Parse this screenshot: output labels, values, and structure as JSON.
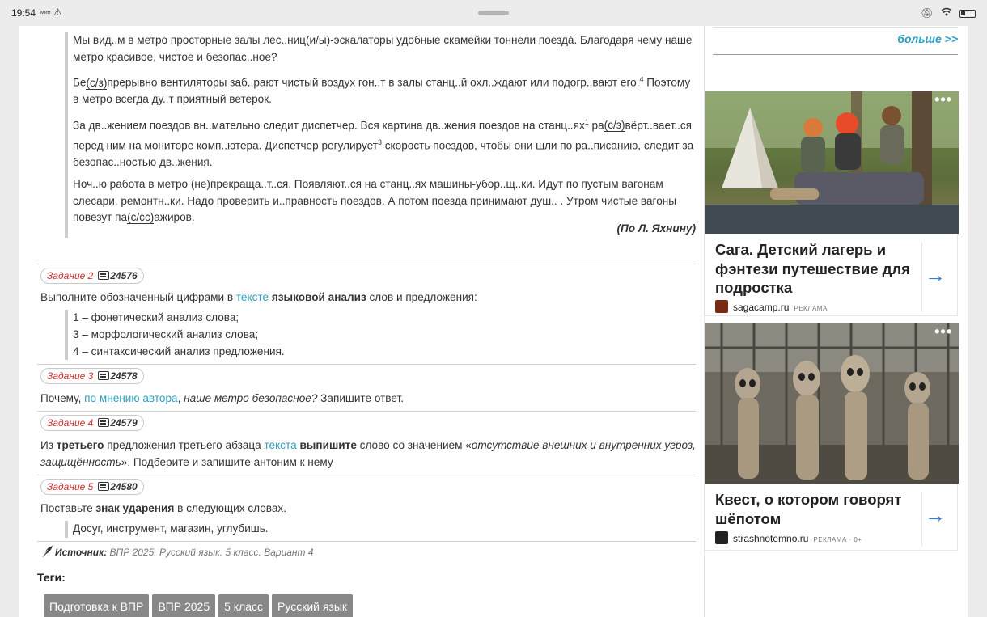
{
  "status_bar": {
    "time": "19:54",
    "mini_label": "мин",
    "warning_icon": "warning-triangle-icon",
    "icons": [
      "bell-muted-icon",
      "wifi-icon",
      "battery-icon"
    ]
  },
  "text": {
    "p1": "Мы вид..м в метро просторные залы лес..ниц(и/ы)-эскалаторы удобные скамейки тоннели поездá. Благодаря чему наше метро красивое, чистое и безопас..ное?",
    "p2_a": "Бе",
    "p2_u": "(с/з)",
    "p2_b": "прерывно вентиляторы заб..рают чистый воздух гон..т в залы станц..й охл..ждают или подогр..вают его.",
    "p2_sup": "4",
    "p2_c": " Поэтому в метро всегда ду..т приятный ветерок.",
    "p3_a": "За дв..жением поездов вн..мательно следит диспетчер. Вся картина дв..жения поездов на станц..ях",
    "p3_sup1": "1",
    "p3_b": " ра",
    "p3_u": "(с/з)",
    "p3_c": "вёрт..вает..ся перед ним на мониторе комп..ютера. Диспетчер регулирует",
    "p3_sup2": "3",
    "p3_d": " скорость поездов, чтобы они шли по ра..писанию, следит за безопас..ностью дв..жения.",
    "p4_a": "Ноч..ю работа в метро (не)прекраща..т..ся. Появляют..ся на станц..ях машины-убор..щ..ки. Идут по пустым вагонам слесари, ремонтн..ки. Надо проверить и..правность поездов. А потом поезда принимают душ.. . Утром чистые вагоны повезут па",
    "p4_u": "(с/сс)",
    "p4_b": "ажиров.",
    "author": "(По Л. Яхнину)"
  },
  "tasks": [
    {
      "name": "Задание 2",
      "num": "24576",
      "text_a": "Выполните обозначенный цифрами в ",
      "link": "тексте",
      "text_b": " ",
      "bold": "языковой анализ",
      "text_c": " слов и предложения:",
      "items": [
        "1 – фонетический анализ слова;",
        "3 – морфологический анализ слова;",
        "4 – синтаксический анализ предложения."
      ]
    },
    {
      "name": "Задание 3",
      "num": "24578",
      "text_a": "Почему, ",
      "link": "по мнению автора",
      "text_b": ", ",
      "italic": "наше метро безопасное?",
      "text_c": " Запишите ответ."
    },
    {
      "name": "Задание 4",
      "num": "24579",
      "text_a": "Из ",
      "bold1": "третьего",
      "text_b": " предложения третьего абзаца ",
      "link": "текста",
      "text_c": " ",
      "bold2": "выпишите",
      "text_d": " слово со значением «",
      "italic": "отсутствие внешних и внутренних угроз, защищённость",
      "text_e": "». Подберите и запишите антоним к нему"
    },
    {
      "name": "Задание 5",
      "num": "24580",
      "text_a": "Поставьте ",
      "bold": "знак ударения",
      "text_b": " в следующих словах.",
      "words": "Досуг, инструмент, магазин, углубишь."
    }
  ],
  "source": {
    "label": "Источник:",
    "value": " ВПР 2025. Русский язык. 5 класс. Вариант 4"
  },
  "tags": {
    "title": "Теги:",
    "items": [
      "Подготовка к ВПР",
      "ВПР 2025",
      "5 класс",
      "Русский язык"
    ]
  },
  "sidebar": {
    "more": "больше >>",
    "ads": [
      {
        "title": "Сага. Детский лагерь и фэнтези путешествие для подростка",
        "domain": "sagacamp.ru",
        "mark": "РЕКЛАМА",
        "dots": "•••"
      },
      {
        "title": "Квест, о котором говорят шёпотом",
        "domain": "strashnotemno.ru",
        "mark": "РЕКЛАМА · 0+",
        "dots": "•••"
      }
    ]
  },
  "colors": {
    "link": "#2a9fc0",
    "task_label": "#d03030",
    "ad_arrow": "#2f7de1",
    "tag_bg": "#888888"
  }
}
